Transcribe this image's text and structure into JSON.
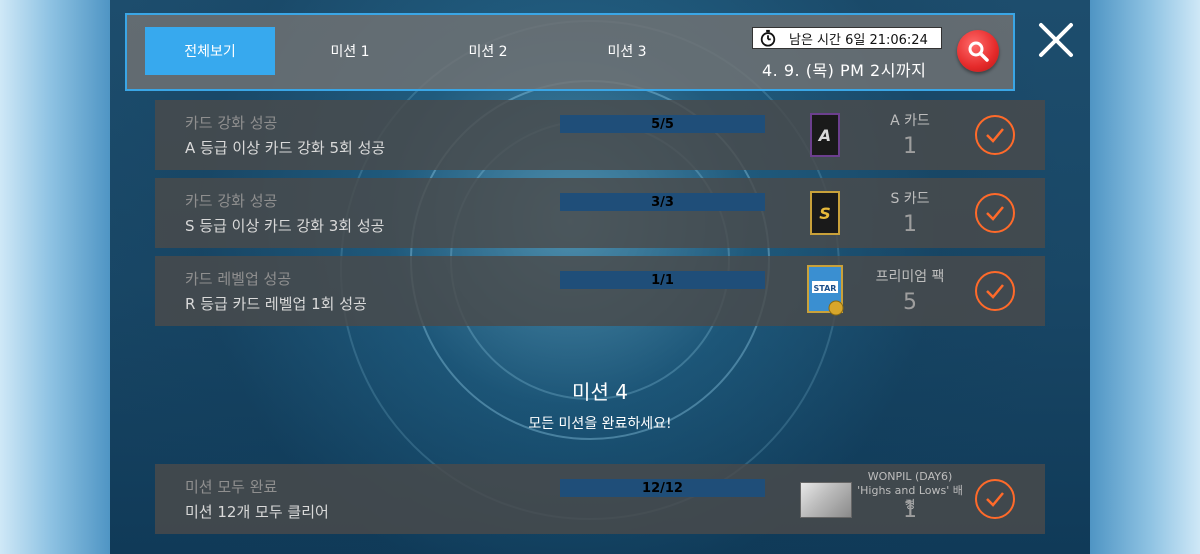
{
  "header": {
    "tabs": [
      {
        "label": "전체보기",
        "active": true
      },
      {
        "label": "미션 1",
        "active": false
      },
      {
        "label": "미션 2",
        "active": false
      },
      {
        "label": "미션 3",
        "active": false
      }
    ],
    "timer_text": "남은 시간 6일 21:06:24",
    "deadline": "4. 9. (목) PM 2시까지"
  },
  "missions": [
    {
      "title": "카드 강화 성공",
      "desc": "A 등급 이상 카드 강화 5회 성공",
      "progress": "5/5",
      "reward_name": "A 카드",
      "reward_count": "1",
      "reward_icon": "a-card-icon"
    },
    {
      "title": "카드 강화 성공",
      "desc": "S 등급 이상 카드 강화 3회 성공",
      "progress": "3/3",
      "reward_name": "S 카드",
      "reward_count": "1",
      "reward_icon": "s-card-icon"
    },
    {
      "title": "카드 레벨업 성공",
      "desc": "R 등급 카드 레벨업 1회 성공",
      "progress": "1/1",
      "reward_name": "프리미엄 팩",
      "reward_count": "5",
      "reward_icon": "premium-pack-icon"
    }
  ],
  "mission4": {
    "title": "미션 4",
    "subtitle": "모든 미션을 완료하세요!"
  },
  "final_mission": {
    "title": "미션 모두 완료",
    "desc": "미션 12개 모두 클리어",
    "progress": "12/12",
    "reward_name_line1": "WONPIL (DAY6)",
    "reward_name_line2": "'Highs and Lows' 배경",
    "reward_count": "1"
  },
  "pack_label": "STAR",
  "colors": {
    "accent": "#37a9ee",
    "progress_bar": "#1f4e79",
    "check": "#ff6a2a",
    "search": "#e52a2a"
  }
}
